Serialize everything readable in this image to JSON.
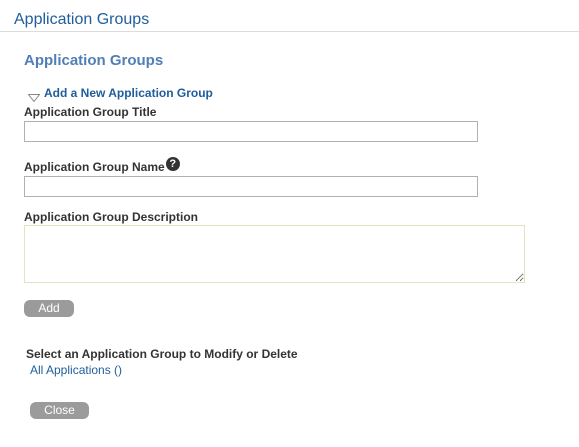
{
  "header": {
    "title": "Application Groups"
  },
  "section": {
    "title": "Application Groups",
    "add_toggle_label": "Add a New Application Group"
  },
  "form": {
    "title_label": "Application Group Title",
    "title_value": "",
    "name_label": "Application Group Name",
    "name_value": "",
    "help_icon_glyph": "?",
    "description_label": "Application Group Description",
    "description_value": "",
    "add_button": "Add"
  },
  "groups": {
    "select_label": "Select an Application Group to Modify or Delete",
    "items": [
      {
        "label": "All Applications ()"
      }
    ]
  },
  "footer": {
    "close_button": "Close"
  },
  "icons": {
    "add_toggle": "triangle-down-icon",
    "help": "help-icon"
  },
  "colors": {
    "link": "#1f5d9b",
    "section_title": "#4f7fb6",
    "button_bg": "#9b9b9b",
    "label": "#333333"
  }
}
